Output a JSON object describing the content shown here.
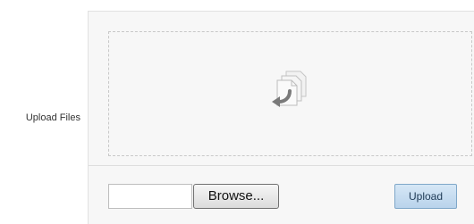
{
  "form": {
    "field_label": "Upload Files"
  },
  "dropzone": {
    "icon": "file-drop-icon"
  },
  "file_picker": {
    "value": "",
    "browse_label": "Browse..."
  },
  "actions": {
    "upload_label": "Upload"
  },
  "colors": {
    "panel_background": "#f7f7f7",
    "upload_button": "#c7dcf0",
    "icon_arrow": "#7a7a7a"
  }
}
